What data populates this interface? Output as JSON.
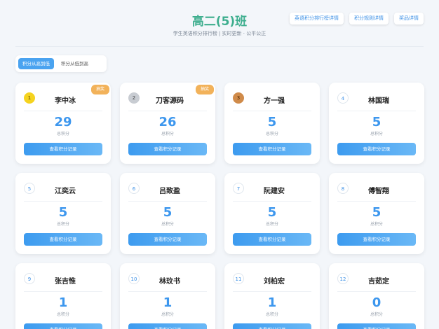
{
  "header": {
    "title": "高二(5)班",
    "subtitle": "学生英语积分排行榜 | 实时更新 · 公平公正",
    "links": [
      "英语积分排行榜详情",
      "积分规则详情",
      "奖品详情"
    ]
  },
  "sort": {
    "options": [
      "积分从高到低",
      "积分从低到高"
    ],
    "active_index": 0
  },
  "score_label": "总积分",
  "record_label": "查看积分记录",
  "colors": {
    "accent": "#3d97ee",
    "title": "#3dae8e",
    "badge": "#f2b25a"
  },
  "students": [
    {
      "rank": "1",
      "name": "李中冰",
      "score": "29",
      "badge": "抽奖"
    },
    {
      "rank": "2",
      "name": "刀客源码",
      "score": "26",
      "badge": "抽奖"
    },
    {
      "rank": "3",
      "name": "方一强",
      "score": "5"
    },
    {
      "rank": "4",
      "name": "林国瑞",
      "score": "5"
    },
    {
      "rank": "5",
      "name": "江奕云",
      "score": "5"
    },
    {
      "rank": "6",
      "name": "吕致盈",
      "score": "5"
    },
    {
      "rank": "7",
      "name": "阮建安",
      "score": "5"
    },
    {
      "rank": "8",
      "name": "傅智翔",
      "score": "5"
    },
    {
      "rank": "9",
      "name": "张吉惟",
      "score": "1"
    },
    {
      "rank": "10",
      "name": "林玟书",
      "score": "1"
    },
    {
      "rank": "11",
      "name": "刘柏宏",
      "score": "1"
    },
    {
      "rank": "12",
      "name": "吉茹定",
      "score": "0"
    }
  ]
}
